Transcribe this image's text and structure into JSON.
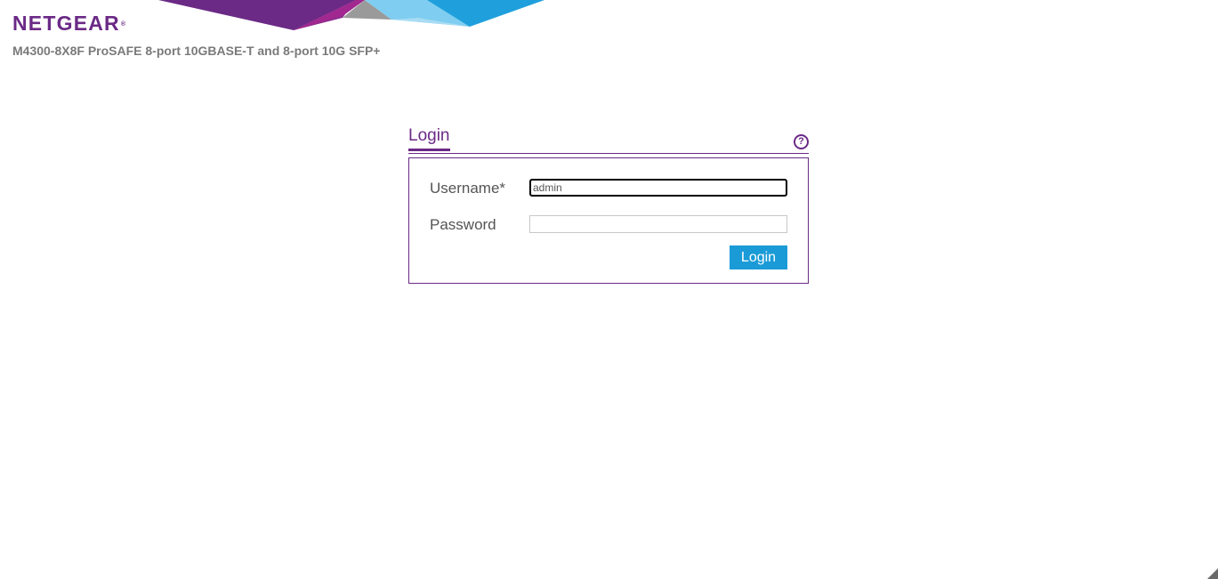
{
  "brand": {
    "logo_text": "NETGEAR",
    "logo_mark": "®",
    "product_name": "M4300-8X8F ProSAFE 8-port 10GBASE-T and 8-port 10G SFP+"
  },
  "login": {
    "tab_label": "Login",
    "help_icon": "question-circle-icon",
    "username_label": "Username*",
    "username_value": "admin",
    "password_label": "Password",
    "password_value": "",
    "submit_label": "Login"
  },
  "colors": {
    "brand_purple": "#6b2a86",
    "button_blue": "#1a9bd7",
    "label_gray": "#555555"
  }
}
